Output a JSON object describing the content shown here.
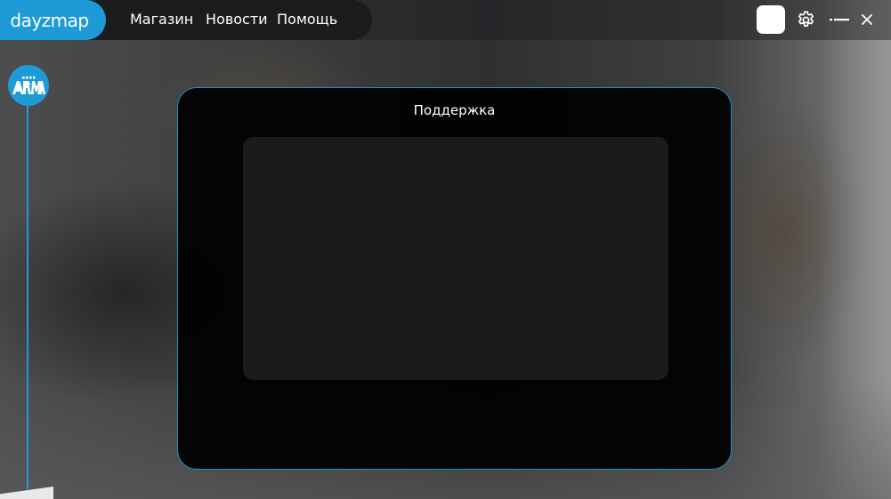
{
  "app": {
    "logo_text": "dayzmap",
    "accent_color": "#1e9bd7"
  },
  "nav": {
    "items": [
      {
        "label": "Магазин"
      },
      {
        "label": "Новости"
      },
      {
        "label": "Помощь"
      }
    ]
  },
  "window_controls": {
    "avatar_icon": "avatar",
    "settings_icon": "gear-icon",
    "minimize_icon": "minimize-icon",
    "close_icon": "close-icon"
  },
  "sidebar": {
    "games": [
      {
        "name": "ARMA",
        "icon": "arma-logo"
      }
    ]
  },
  "dialog": {
    "title": "Поддержка"
  }
}
